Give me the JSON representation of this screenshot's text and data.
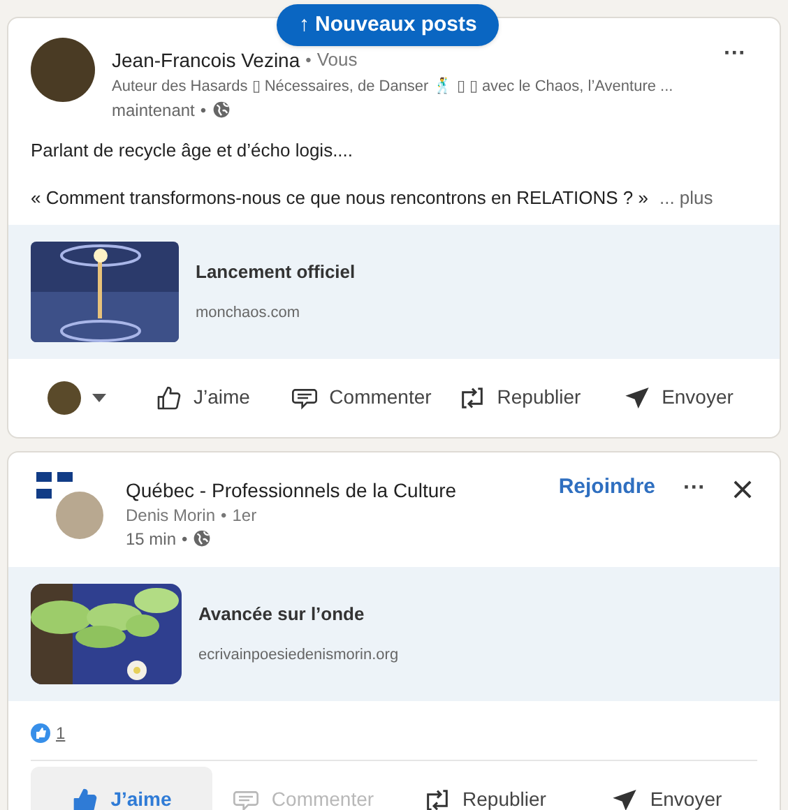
{
  "new_posts_button": {
    "arrow": "↑",
    "label": "Nouveaux posts"
  },
  "posts": [
    {
      "kind": "person",
      "author": "Jean-Francois Vezina",
      "separator": "•",
      "degree": "Vous",
      "more_options": "···",
      "headline": "Auteur des Hasards ▯ Nécessaires, de Danser 🕺 ▯ ▯ avec le Chaos, l’Aventure ...",
      "time": "maintenant",
      "time_separator": "•",
      "text_lines": [
        "Parlant de recycle âge et d’écho logis....",
        "« Comment transformons-nous ce que nous rencontrons en RELATIONS ? »"
      ],
      "more": "... plus",
      "link": {
        "title": "Lancement officiel",
        "domain": "monchaos.com"
      },
      "actions": [
        {
          "kind": "avatar",
          "selected": false,
          "disabled": false
        },
        {
          "kind": "like",
          "label": "J’aime",
          "selected": false,
          "disabled": false
        },
        {
          "kind": "comment",
          "label": "Commenter",
          "selected": false,
          "disabled": false
        },
        {
          "kind": "repost",
          "label": "Republier",
          "selected": false,
          "disabled": false
        },
        {
          "kind": "send",
          "label": "Envoyer",
          "selected": false,
          "disabled": false
        }
      ]
    },
    {
      "kind": "group",
      "group": "Québec - Professionnels de la Culture",
      "join": "Rejoindre",
      "more_options": "···",
      "author": "Denis Morin",
      "separator": "•",
      "degree": "1er",
      "time": "15 min",
      "time_separator": "•",
      "link": {
        "title": "Avancée sur l’onde",
        "domain": "ecrivainpoesiedenismorin.org"
      },
      "reactions_count": "1",
      "actions": [
        {
          "kind": "like",
          "label": "J’aime",
          "selected": true,
          "disabled": false
        },
        {
          "kind": "comment",
          "label": "Commenter",
          "selected": false,
          "disabled": true
        },
        {
          "kind": "repost",
          "label": "Republier",
          "selected": false,
          "disabled": false
        },
        {
          "kind": "send",
          "label": "Envoyer",
          "selected": false,
          "disabled": false
        }
      ]
    }
  ]
}
